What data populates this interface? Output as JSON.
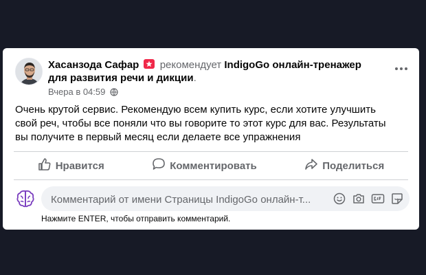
{
  "post": {
    "author_name": "Хасанзода Сафар",
    "recommends_text": "рекомендует",
    "page_name": "IndigoGo онлайн-тренажер для развития речи и дикции",
    "page_name_suffix": ".",
    "timestamp": "Вчера в 04:59",
    "audience_icon": "globe-icon",
    "body_text": "Очень крутой сервис. Рекомендую всем купить курс, если хотите улучшить свой реч, чтобы все поняли что вы говорите то этот курс для вас. Результаты вы получите в первый месяц если делаете все упражнения"
  },
  "actions": {
    "like_label": "Нравится",
    "comment_label": "Комментировать",
    "share_label": "Поделиться"
  },
  "comment_composer": {
    "placeholder": "Комментарий от имени Страницы IndigoGo онлайн-т...",
    "icons": [
      "emoji-icon",
      "camera-icon",
      "gif-icon",
      "sticker-icon"
    ],
    "hint": "Нажмите ENTER, чтобы отправить комментарий."
  },
  "colors": {
    "background": "#171a26",
    "card": "#ffffff",
    "recommend_badge": "#f02849",
    "page_avatar_purple": "#7b3fbf"
  }
}
